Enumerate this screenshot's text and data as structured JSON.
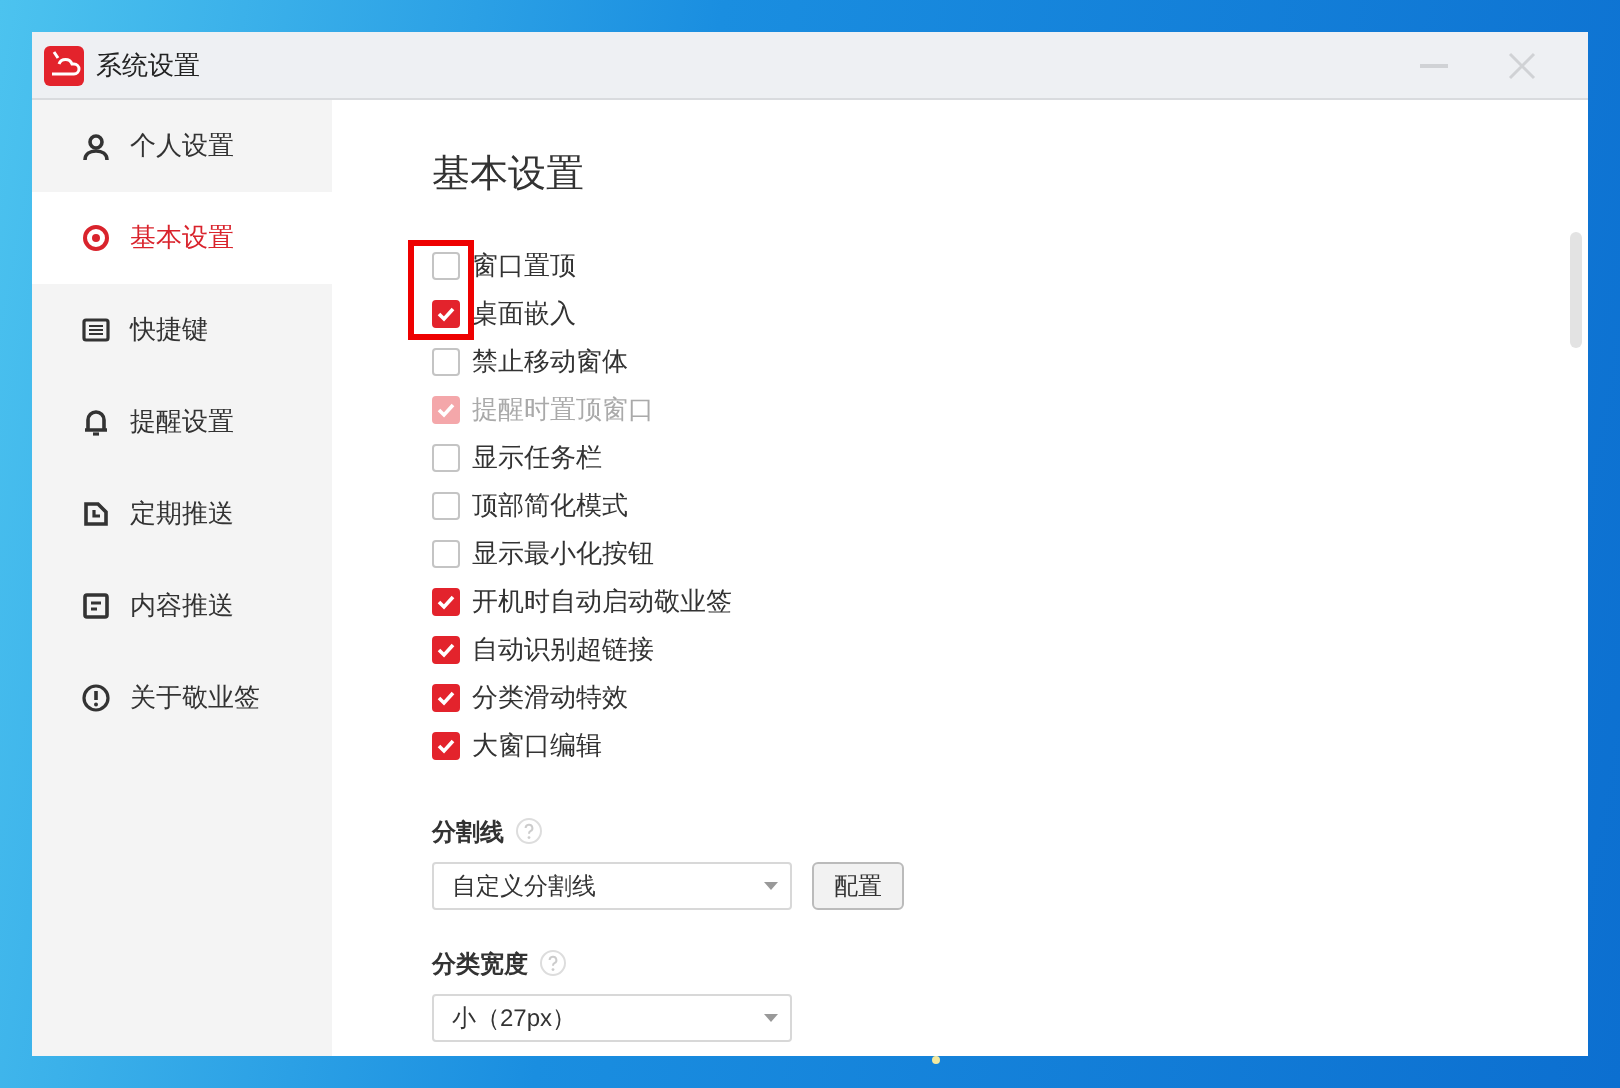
{
  "window": {
    "title": "系统设置"
  },
  "sidebar": {
    "items": [
      {
        "label": "个人设置",
        "selected": false
      },
      {
        "label": "基本设置",
        "selected": true
      },
      {
        "label": "快捷键",
        "selected": false
      },
      {
        "label": "提醒设置",
        "selected": false
      },
      {
        "label": "定期推送",
        "selected": false
      },
      {
        "label": "内容推送",
        "selected": false
      },
      {
        "label": "关于敬业签",
        "selected": false
      }
    ]
  },
  "content": {
    "title": "基本设置",
    "options": [
      {
        "label": "窗口置顶",
        "checked": false,
        "disabled": false,
        "highlighted": true
      },
      {
        "label": "桌面嵌入",
        "checked": true,
        "disabled": false,
        "highlighted": true
      },
      {
        "label": "禁止移动窗体",
        "checked": false,
        "disabled": false,
        "highlighted": false
      },
      {
        "label": "提醒时置顶窗口",
        "checked": true,
        "disabled": true,
        "highlighted": false
      },
      {
        "label": "显示任务栏",
        "checked": false,
        "disabled": false,
        "highlighted": false
      },
      {
        "label": "顶部简化模式",
        "checked": false,
        "disabled": false,
        "highlighted": false
      },
      {
        "label": "显示最小化按钮",
        "checked": false,
        "disabled": false,
        "highlighted": false
      },
      {
        "label": "开机时自动启动敬业签",
        "checked": true,
        "disabled": false,
        "highlighted": false
      },
      {
        "label": "自动识别超链接",
        "checked": true,
        "disabled": false,
        "highlighted": false
      },
      {
        "label": "分类滑动特效",
        "checked": true,
        "disabled": false,
        "highlighted": false
      },
      {
        "label": "大窗口编辑",
        "checked": true,
        "disabled": false,
        "highlighted": false
      }
    ],
    "groups": [
      {
        "label": "分割线",
        "value": "自定义分割线",
        "button": "配置"
      },
      {
        "label": "分类宽度",
        "value": "小（27px）"
      }
    ]
  }
}
